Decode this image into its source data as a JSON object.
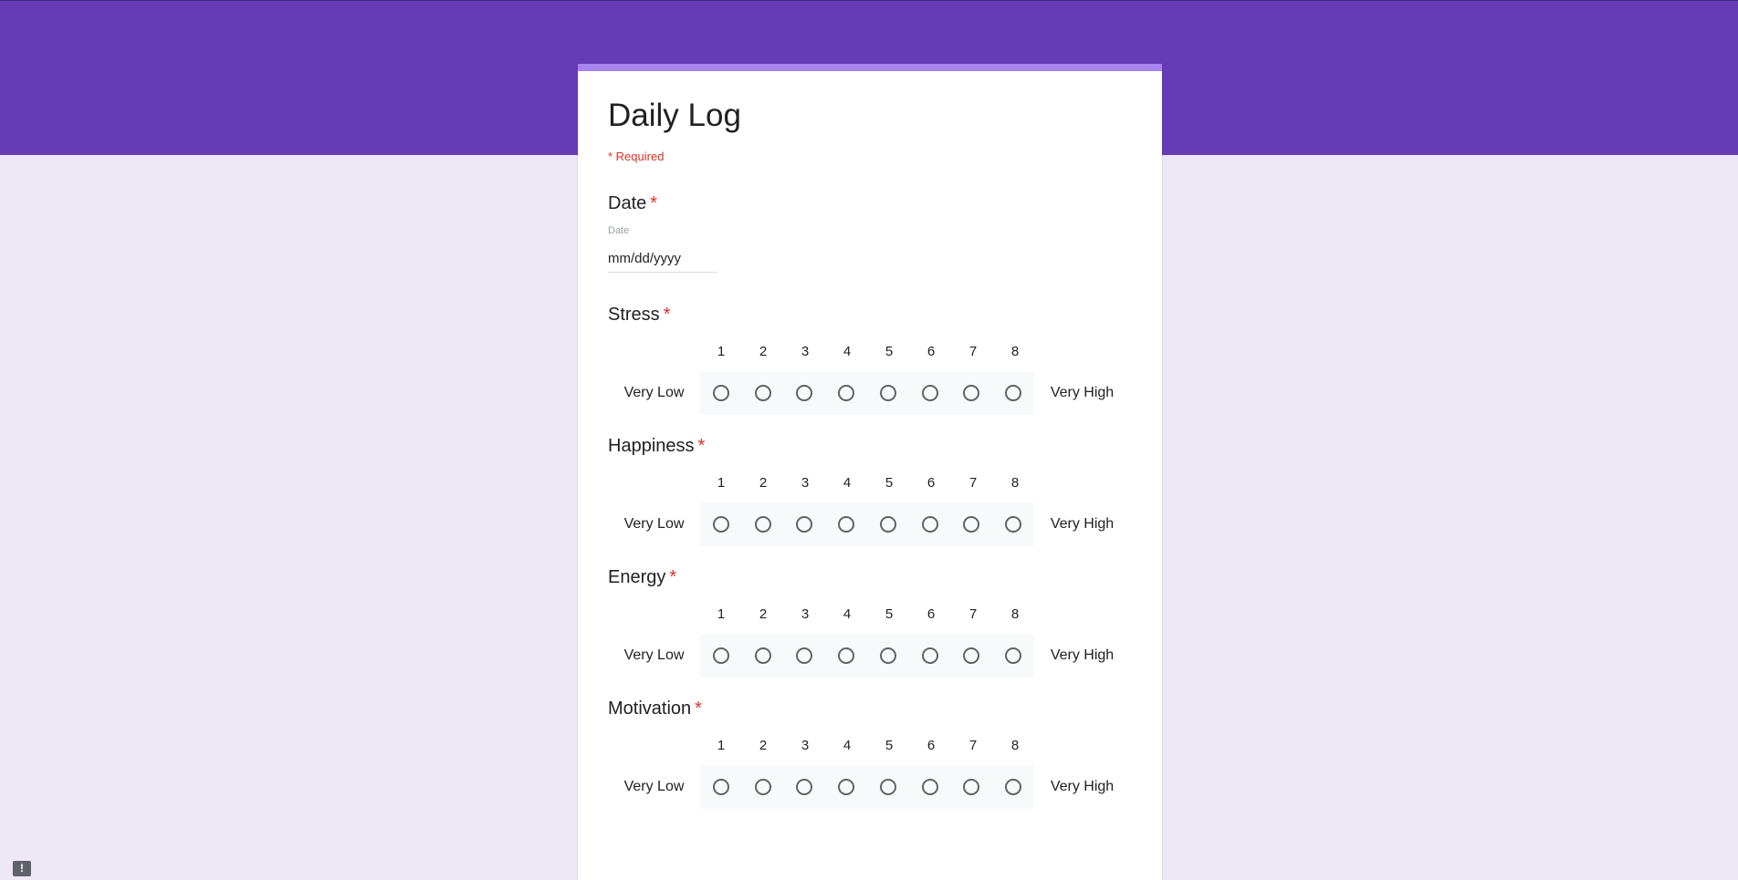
{
  "form": {
    "title": "Daily Log",
    "required_note": "* Required"
  },
  "date_question": {
    "title": "Date",
    "required_star": "*",
    "sublabel": "Date",
    "placeholder": "mm/dd/yyyy"
  },
  "scales": [
    {
      "title": "Stress",
      "required_star": "*",
      "low_label": "Very Low",
      "high_label": "Very High",
      "options": [
        "1",
        "2",
        "3",
        "4",
        "5",
        "6",
        "7",
        "8"
      ]
    },
    {
      "title": "Happiness",
      "required_star": "*",
      "low_label": "Very Low",
      "high_label": "Very High",
      "options": [
        "1",
        "2",
        "3",
        "4",
        "5",
        "6",
        "7",
        "8"
      ]
    },
    {
      "title": "Energy",
      "required_star": "*",
      "low_label": "Very Low",
      "high_label": "Very High",
      "options": [
        "1",
        "2",
        "3",
        "4",
        "5",
        "6",
        "7",
        "8"
      ]
    },
    {
      "title": "Motivation",
      "required_star": "*",
      "low_label": "Very Low",
      "high_label": "Very High",
      "options": [
        "1",
        "2",
        "3",
        "4",
        "5",
        "6",
        "7",
        "8"
      ]
    }
  ],
  "feedback": {
    "icon_glyph": "!"
  },
  "colors": {
    "header_band": "#673ab7",
    "page_background": "#ede7f6",
    "accent_strip": "#a883f2",
    "required_red": "#d93025"
  }
}
